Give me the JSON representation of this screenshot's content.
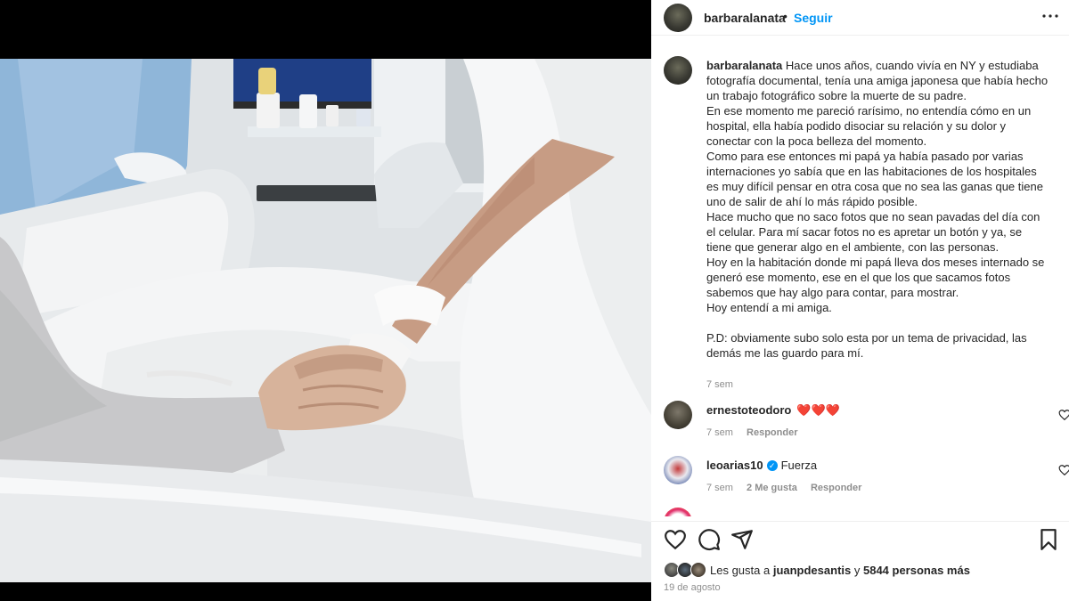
{
  "post": {
    "username": "barbaralanata",
    "follow_label": "Seguir",
    "separator": "•",
    "caption_username": "barbaralanata",
    "caption": "Hace unos años, cuando vivía en NY y estudiaba fotografía documental, tenía una amiga japonesa que había hecho un trabajo fotográfico sobre la muerte de su padre.\nEn ese momento me pareció rarísimo, no entendía cómo en un hospital, ella había podido disociar su relación y su dolor y conectar con la poca belleza del momento.\nComo para ese entonces mi papá ya había pasado por varias internaciones yo sabía que en las habitaciones de los hospitales es muy difícil pensar en otra cosa que no sea las ganas que tiene uno de salir de ahí lo más rápido posible.\nHace mucho que no saco fotos que no sean pavadas del día con el celular. Para mí sacar fotos no es apretar un botón y ya, se tiene que generar algo en el ambiente, con las personas.\nHoy en la habitación donde mi papá lleva dos meses internado se generó ese momento, ese en el que los que sacamos fotos sabemos que hay algo para contar, para mostrar.\nHoy entendí a mi amiga.\n\nP.D: obviamente subo solo esta por un tema de privacidad, las demás me las guardo para mí.",
    "caption_time": "7 sem"
  },
  "comments": [
    {
      "username": "ernestoteodoro",
      "text": "❤️❤️❤️",
      "time": "7 sem",
      "likes": "",
      "reply_label": "Responder",
      "verified": false
    },
    {
      "username": "leoarias10",
      "text": "Fuerza",
      "time": "7 sem",
      "likes": "2 Me gusta",
      "reply_label": "Responder",
      "verified": true
    }
  ],
  "likes": {
    "prefix": "Les gusta a ",
    "user": "juanpdesantis",
    "middle": " y ",
    "count": "5844 personas más"
  },
  "date": "19 de agosto",
  "icons": {
    "more": "more-horizontal-icon",
    "like": "heart-outline-icon",
    "comment": "comment-bubble-icon",
    "share": "paper-plane-icon",
    "save": "bookmark-icon",
    "verified": "verified-badge-icon"
  },
  "colors": {
    "accent": "#0095f6",
    "secondary_text": "#8e8e8e",
    "heart": "#ed4956"
  }
}
